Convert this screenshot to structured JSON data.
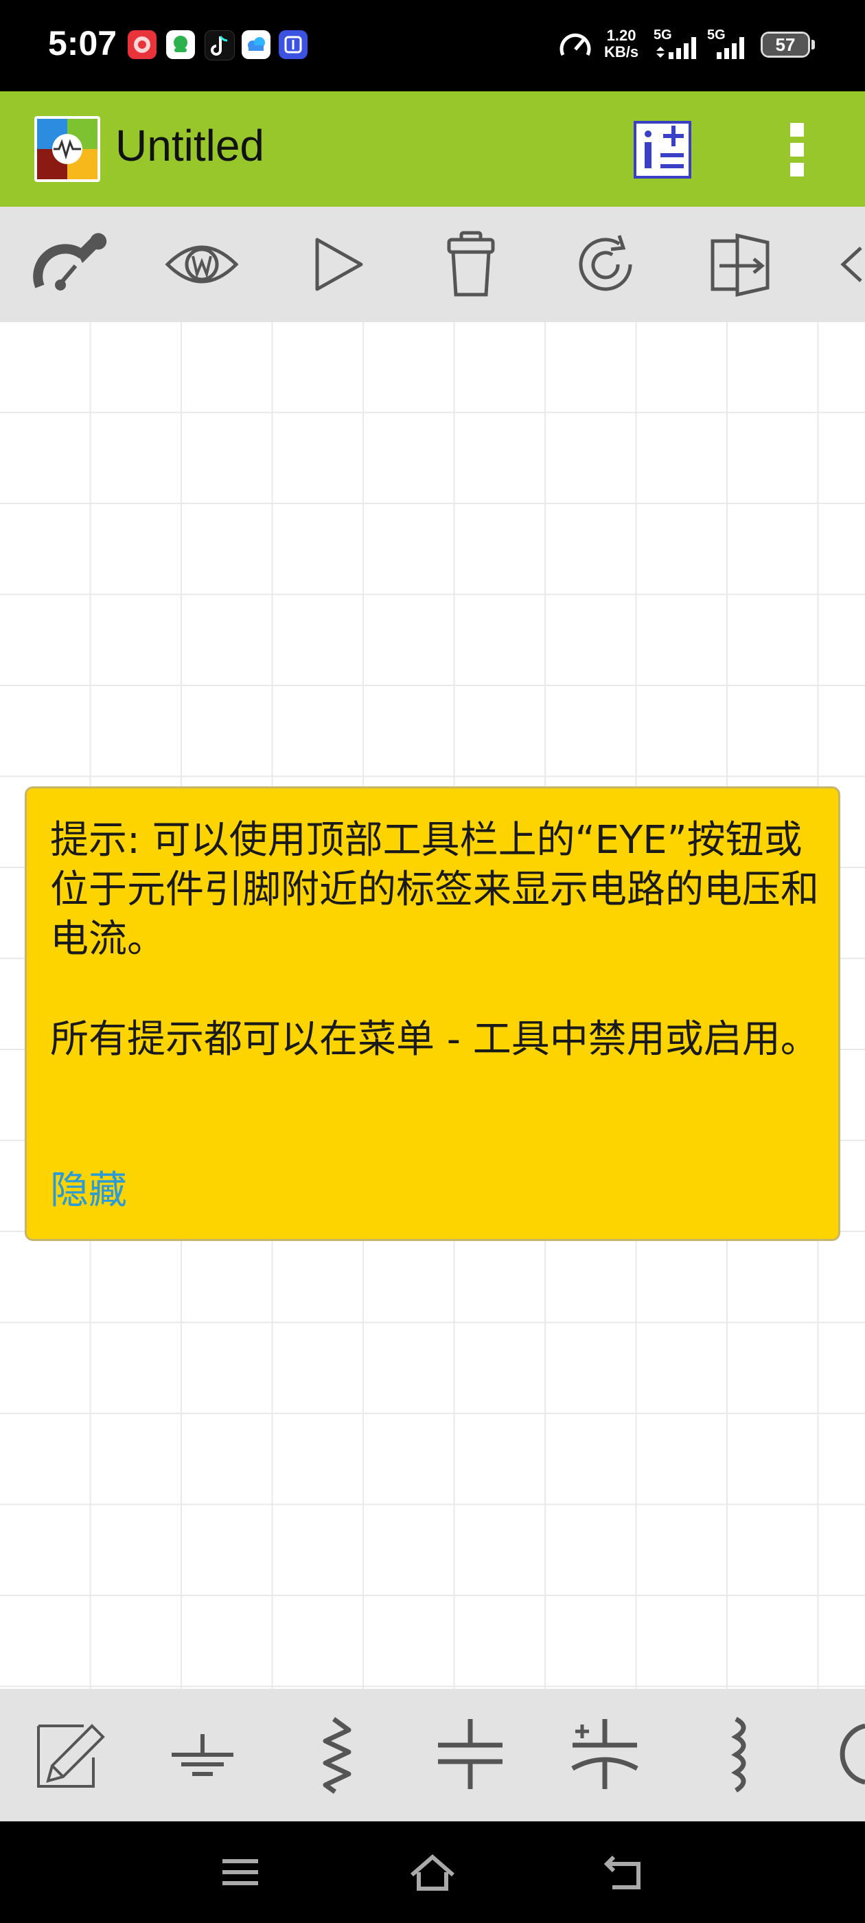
{
  "status_bar": {
    "time": "5:07",
    "net_speed_value": "1.20",
    "net_speed_unit": "KB/s",
    "sim1_label": "5G",
    "sim2_label": "5G",
    "battery": "57"
  },
  "app_bar": {
    "title": "Untitled"
  },
  "hint": {
    "text": "提示: 可以使用顶部工具栏上的“EYE”按钮或位于元件引脚附近的标签来显示电路的电压和电流。",
    "text2": "所有提示都可以在菜单 - 工具中禁用或启用。",
    "hide_label": "隐藏"
  },
  "colors": {
    "app_bar": "#98c72b",
    "hint_bg": "#fdd400",
    "hide_link": "#2a9bd6",
    "toolbar_bg": "#e3e3e3"
  },
  "icons": {
    "toolbar": [
      "settings-gauge-icon",
      "eye-w-icon",
      "play-icon",
      "trash-icon",
      "rotate-icon",
      "flip-icon",
      "more-tools-icon"
    ],
    "components": [
      "pencil-icon",
      "ground-icon",
      "resistor-icon",
      "capacitor-icon",
      "polarized-capacitor-icon",
      "inductor-icon",
      "more-components-icon"
    ]
  }
}
